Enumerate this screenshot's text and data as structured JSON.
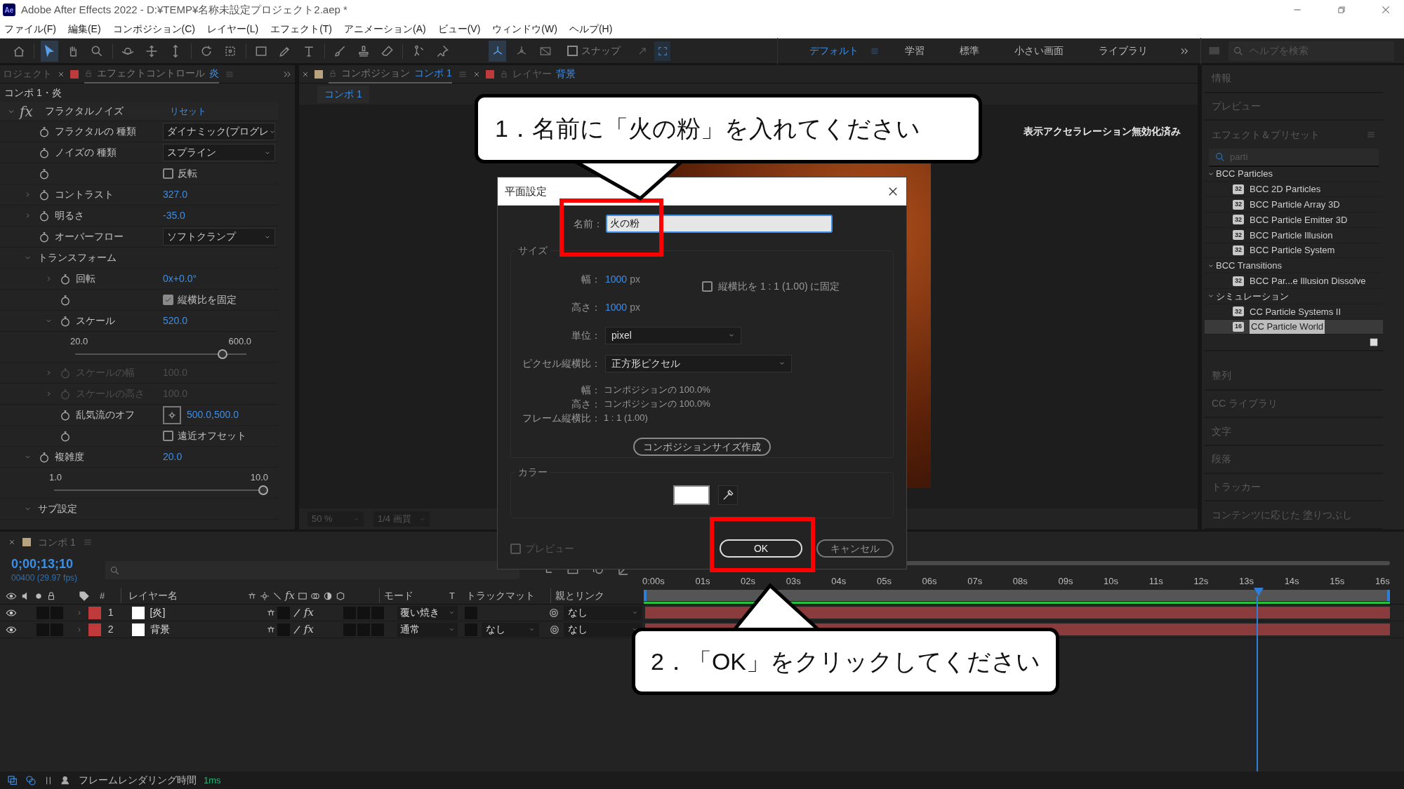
{
  "app": {
    "logo": "Ae",
    "title": "Adobe After Effects 2022 - D:¥TEMP¥名称未設定プロジェクト2.aep *"
  },
  "menu": [
    "ファイル(F)",
    "編集(E)",
    "コンポジション(C)",
    "レイヤー(L)",
    "エフェクト(T)",
    "アニメーション(A)",
    "ビュー(V)",
    "ウィンドウ(W)",
    "ヘルプ(H)"
  ],
  "toolbar": {
    "tools": [
      {
        "kind": "home",
        "selected": false
      },
      {
        "kind": "select",
        "selected": true
      },
      {
        "kind": "hand",
        "selected": false
      },
      {
        "kind": "zoom",
        "selected": false
      },
      {
        "kind": "orbit",
        "selected": false
      },
      {
        "kind": "pan",
        "selected": false
      },
      {
        "kind": "dolly",
        "selected": false
      },
      {
        "kind": "rotate",
        "selected": false
      },
      {
        "kind": "anchor",
        "selected": false
      },
      {
        "kind": "rect",
        "selected": false
      },
      {
        "kind": "pen",
        "selected": false
      },
      {
        "kind": "type",
        "selected": false
      },
      {
        "kind": "brush",
        "selected": false
      },
      {
        "kind": "stamp",
        "selected": false
      },
      {
        "kind": "eraser",
        "selected": false
      },
      {
        "kind": "roto",
        "selected": false
      },
      {
        "kind": "pin",
        "selected": false
      }
    ],
    "axis_tools": [
      {
        "kind": "local",
        "selected": true
      },
      {
        "kind": "world",
        "selected": false
      },
      {
        "kind": "view",
        "selected": false
      }
    ],
    "snap": {
      "label": "スナップ",
      "checked": false
    },
    "workspaces": [
      {
        "label": "デフォルト",
        "selected": true
      },
      {
        "label": "学習",
        "selected": false
      },
      {
        "label": "標準",
        "selected": false
      },
      {
        "label": "小さい画面",
        "selected": false
      },
      {
        "label": "ライブラリ",
        "selected": false
      }
    ],
    "help_search": {
      "placeholder": "ヘルプを検索"
    }
  },
  "effect_panel": {
    "tabs": [
      {
        "label": "ロジェクト",
        "selected": false
      },
      {
        "label": "エフェクトコントロール",
        "target": "炎",
        "color": "#c0393b",
        "selected": true
      }
    ],
    "breadcrumb": "コンポ 1・炎",
    "effect": {
      "fx": "fx",
      "name": "フラクタルノイズ",
      "reset": "リセット",
      "expanded": true
    },
    "rows": [
      {
        "kind": "dropdown",
        "label": "フラクタルの 種類",
        "value": "ダイナミック(プログレ",
        "disabled": false
      },
      {
        "kind": "dropdown",
        "label": "ノイズの 種類",
        "value": "スプライン",
        "disabled": false
      },
      {
        "kind": "checkbox",
        "text": "反転",
        "checked": false,
        "disabled": false
      },
      {
        "kind": "value",
        "label": "コントラスト",
        "value": "327.0",
        "expanded": false,
        "disabled": false
      },
      {
        "kind": "value",
        "label": "明るさ",
        "value": "-35.0",
        "expanded": false,
        "disabled": false
      },
      {
        "kind": "dropdown",
        "label": "オーバーフロー",
        "value": "ソフトクランプ",
        "disabled": false
      },
      {
        "kind": "group",
        "label": "トランスフォーム",
        "expanded": true,
        "disabled": false,
        "children": [
          {
            "kind": "value",
            "label": "回転",
            "value": "0x+0.0°",
            "expanded": false,
            "disabled": false
          },
          {
            "kind": "checkbox",
            "text": "縦横比を固定",
            "checked": true,
            "disabled": false
          },
          {
            "kind": "value",
            "label": "スケール",
            "value": "520.0",
            "expanded": true,
            "disabled": false
          },
          {
            "kind": "slider",
            "min": "20.0",
            "max": "600.0",
            "level": 0.86,
            "disabled": false
          },
          {
            "kind": "value",
            "label": "スケールの幅",
            "value": "100.0",
            "expanded": false,
            "disabled": true
          },
          {
            "kind": "value",
            "label": "スケールの高さ",
            "value": "100.0",
            "expanded": false,
            "disabled": true
          },
          {
            "kind": "point",
            "label": "乱気流のオフ",
            "value": "500.0,500.0",
            "disabled": false
          },
          {
            "kind": "checkbox",
            "text": "遠近オフセット",
            "checked": false,
            "disabled": false
          }
        ]
      },
      {
        "kind": "value",
        "label": "複雑度",
        "value": "20.0",
        "expanded": true,
        "disabled": false
      },
      {
        "kind": "slider",
        "min": "1.0",
        "max": "10.0",
        "level": 1.0,
        "disabled": false
      },
      {
        "kind": "group",
        "label": "サブ設定",
        "expanded": true,
        "disabled": false
      }
    ]
  },
  "comp_panel": {
    "tabs": [
      {
        "label": "コンポジション",
        "target": "コンポ 1",
        "color": "#b9a37e",
        "selected": true
      },
      {
        "label": "レイヤー",
        "target": "背景",
        "color": "#c0393b",
        "selected": false
      }
    ],
    "breadcrumb": "コンポ 1",
    "notice": "表示アクセラレーション無効化済み",
    "zoom": "50 %",
    "resolution": "1/4 画質"
  },
  "right_panel": {
    "panels_top": [
      "情報",
      "プレビュー"
    ],
    "effects": {
      "title": "エフェクト＆プリセット",
      "search": "parti",
      "tree": [
        {
          "label": "BCC Particles",
          "expanded": true,
          "selected": false,
          "children": [
            {
              "label": "BCC 2D Particles",
              "badge": "32",
              "selected": false
            },
            {
              "label": "BCC Particle Array 3D",
              "badge": "32",
              "selected": false
            },
            {
              "label": "BCC Particle Emitter 3D",
              "badge": "32",
              "selected": false
            },
            {
              "label": "BCC Particle Illusion",
              "badge": "32",
              "selected": false
            },
            {
              "label": "BCC Particle System",
              "badge": "32",
              "selected": false
            }
          ]
        },
        {
          "label": "BCC Transitions",
          "expanded": true,
          "selected": false,
          "children": [
            {
              "label": "BCC Par...e Illusion Dissolve",
              "badge": "32",
              "selected": false
            }
          ]
        },
        {
          "label": "シミュレーション",
          "expanded": true,
          "selected": false,
          "children": [
            {
              "label": "CC Particle Systems II",
              "badge": "32",
              "selected": false
            },
            {
              "label": "CC Particle World",
              "badge": "16",
              "selected": true
            }
          ]
        }
      ]
    },
    "panels_bottom": [
      "整列",
      "CC ライブラリ",
      "文字",
      "段落",
      "トラッカー",
      "コンテンツに応じた 塗りつぶし"
    ]
  },
  "timeline": {
    "tab": {
      "label": "コンポ 1",
      "color": "#b9a37e"
    },
    "timecode": "0;00;13;10",
    "frames": "00400 (29.97 fps)",
    "columns": {
      "number": "#",
      "name": "レイヤー名",
      "fx": "fx",
      "mode": "モード",
      "t": "T",
      "matte": "トラックマット",
      "parent": "親とリンク"
    },
    "ruler": [
      "0:00s",
      "01s",
      "02s",
      "03s",
      "04s",
      "05s",
      "06s",
      "07s",
      "08s",
      "09s",
      "10s",
      "11s",
      "12s",
      "13s",
      "14s",
      "15s",
      "16s"
    ],
    "playhead": {
      "level": 0.834
    },
    "layers": [
      {
        "visible": true,
        "number": "1",
        "name": "[炎]",
        "color": "#c0393b",
        "fx": "fx",
        "fx_on": true,
        "mode": "覆い焼き",
        "parent": "なし"
      },
      {
        "visible": true,
        "number": "2",
        "name": "背景",
        "color": "#c0393b",
        "fx": "fx",
        "fx_on": true,
        "mode": "通常",
        "matte": "なし",
        "parent": "なし"
      }
    ]
  },
  "status_bar": {
    "label": "フレームレンダリング時間",
    "value": "1ms"
  },
  "dialog": {
    "title": "平面設定",
    "name_label": "名前：",
    "name_value": "火の粉",
    "size_label": "サイズ",
    "width_label": "幅：",
    "width_value": "1000",
    "width_unit": "px",
    "height_label": "高さ：",
    "height_value": "1000",
    "height_unit": "px",
    "lock_aspect": {
      "label": "縦横比を 1 : 1 (1.00) に固定",
      "checked": false
    },
    "units_label": "単位：",
    "units_value": "pixel",
    "pixel_aspect_label": "ピクセル縦横比：",
    "pixel_aspect_value": "正方形ピクセル",
    "info": [
      {
        "label": "幅：",
        "value": "コンポジションの 100.0%"
      },
      {
        "label": "高さ：",
        "value": "コンポジションの 100.0%"
      },
      {
        "label": "フレーム縦横比：",
        "value": "1 : 1 (1.00)"
      }
    ],
    "make_comp_size": "コンポジションサイズ作成",
    "color_label": "カラー",
    "color": "#ffffff",
    "preview": {
      "label": "プレビュー",
      "checked": false
    },
    "ok": "OK",
    "cancel": "キャンセル"
  },
  "callouts": [
    "1．名前に「火の粉」を入れてください",
    "2．「OK」をクリックしてください"
  ]
}
